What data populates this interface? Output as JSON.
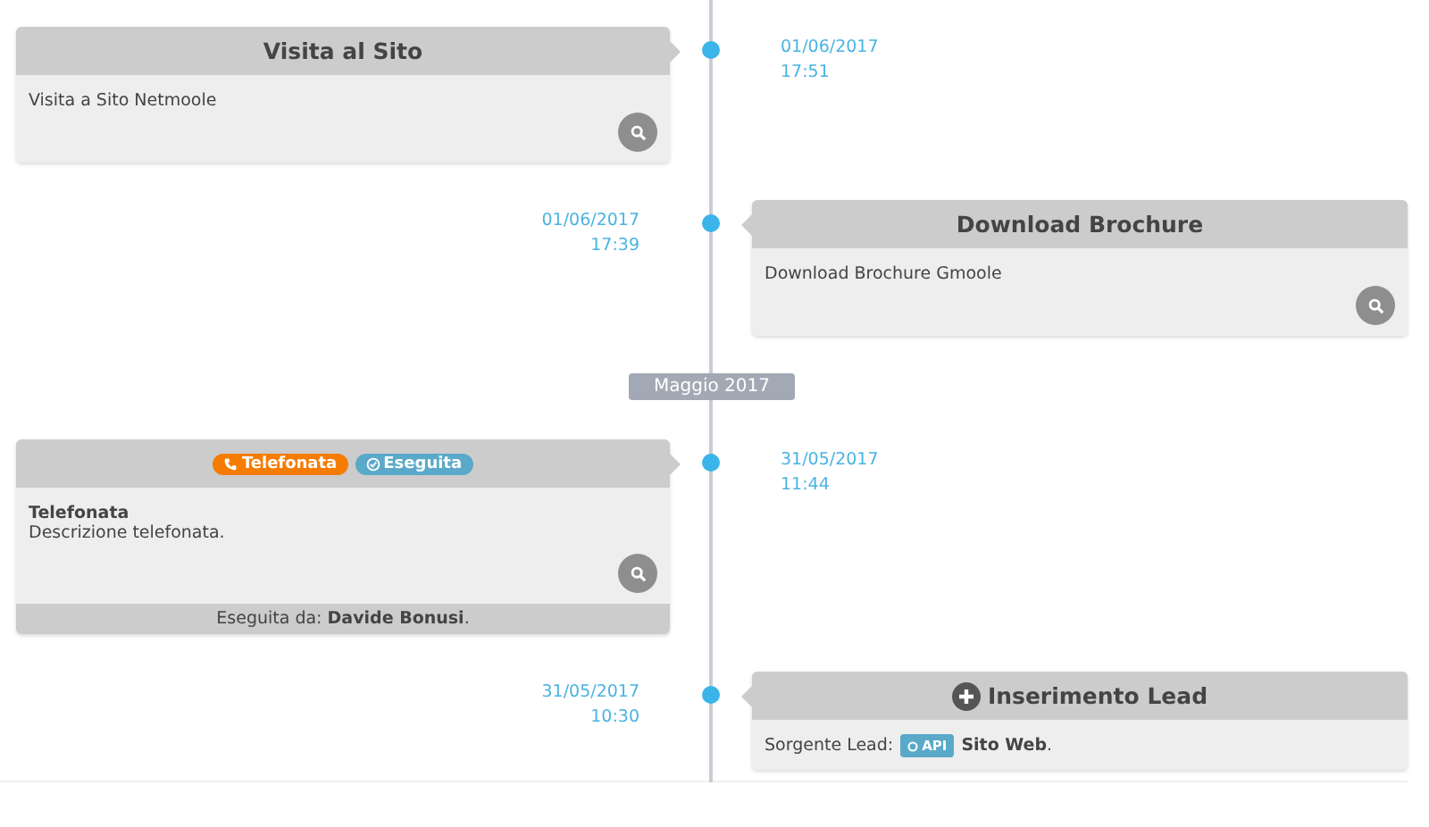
{
  "timeline": [
    {
      "kind": "left",
      "date": "01/06/2017",
      "time": "17:51",
      "title": "Visita al Sito",
      "body_text": "Visita a Sito Netmoole",
      "details_button": true
    },
    {
      "kind": "right",
      "date": "01/06/2017",
      "time": "17:39",
      "title": "Download Brochure",
      "body_text": "Download Brochure Gmoole",
      "details_button": true
    },
    {
      "kind": "separator",
      "label": "Maggio 2017"
    },
    {
      "kind": "left",
      "date": "31/05/2017",
      "time": "11:44",
      "header_badges": [
        {
          "kind": "phone",
          "label": "Telefonata",
          "color": "#f57c00"
        },
        {
          "kind": "check",
          "label": "Eseguita",
          "color": "#5aa9c9"
        }
      ],
      "body_title": "Telefonata",
      "body_text": "Descrizione telefonata.",
      "details_button": true,
      "footer": "Eseguita da: **Davide Bonusi**."
    },
    {
      "kind": "right",
      "date": "31/05/2017",
      "time": "10:30",
      "header_icon": {
        "kind": "plus"
      },
      "title": "Inserimento Lead",
      "source": {
        "label": "Sorgente Lead:",
        "badge": "API",
        "value": "**Sito Web**."
      }
    }
  ]
}
